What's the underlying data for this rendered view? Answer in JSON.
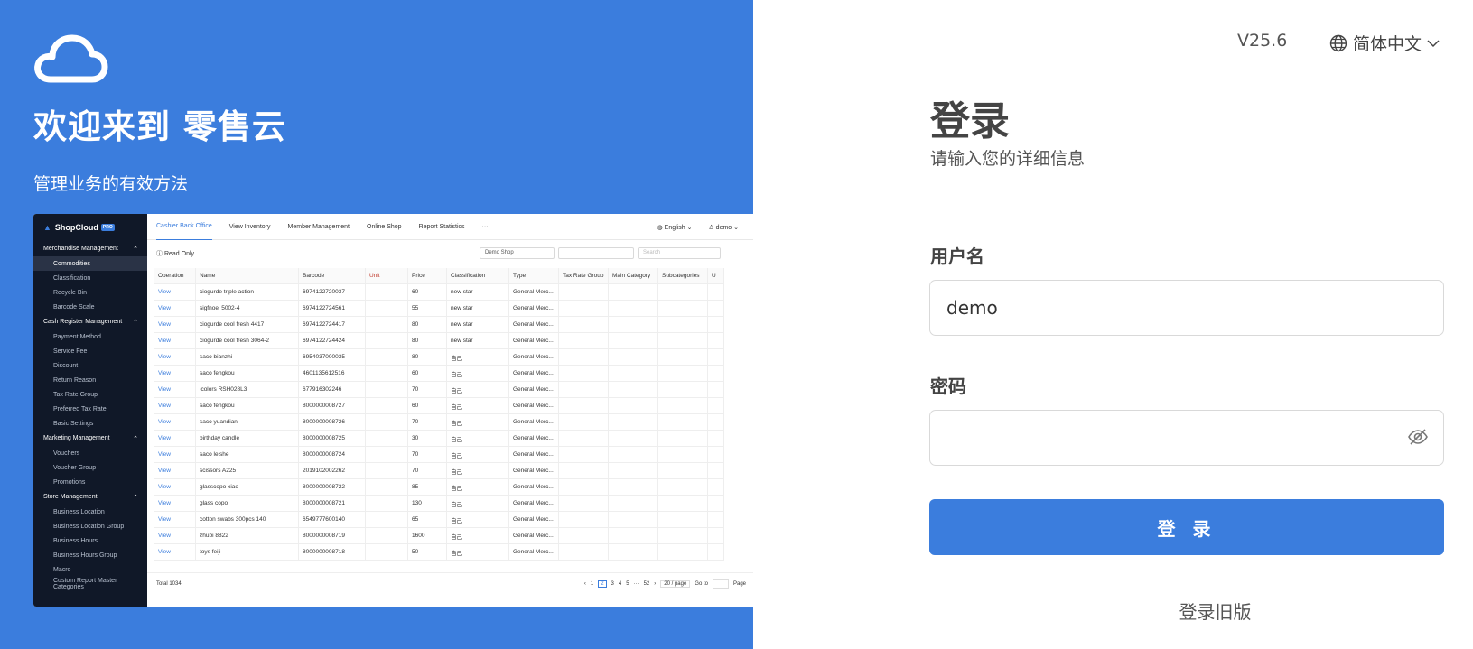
{
  "hero": {
    "welcome": "欢迎来到 零售云",
    "tagline": "管理业务的有效方法"
  },
  "preview": {
    "brand": "ShopCloud",
    "brand_badge": "PRO",
    "sidebar": [
      {
        "type": "group",
        "label": "Merchandise Management"
      },
      {
        "type": "item",
        "label": "Commodities",
        "active": true
      },
      {
        "type": "item",
        "label": "Classification"
      },
      {
        "type": "item",
        "label": "Recycle Bin"
      },
      {
        "type": "item",
        "label": "Barcode Scale"
      },
      {
        "type": "group",
        "label": "Cash Register Management"
      },
      {
        "type": "item",
        "label": "Payment Method"
      },
      {
        "type": "item",
        "label": "Service Fee"
      },
      {
        "type": "item",
        "label": "Discount"
      },
      {
        "type": "item",
        "label": "Return Reason"
      },
      {
        "type": "item",
        "label": "Tax Rate Group"
      },
      {
        "type": "item",
        "label": "Preferred Tax Rate"
      },
      {
        "type": "item",
        "label": "Basic Settings"
      },
      {
        "type": "group",
        "label": "Marketing Management"
      },
      {
        "type": "item",
        "label": "Vouchers"
      },
      {
        "type": "item",
        "label": "Voucher Group"
      },
      {
        "type": "item",
        "label": "Promotions"
      },
      {
        "type": "group",
        "label": "Store Management"
      },
      {
        "type": "item",
        "label": "Business Location"
      },
      {
        "type": "item",
        "label": "Business Location Group"
      },
      {
        "type": "item",
        "label": "Business Hours"
      },
      {
        "type": "item",
        "label": "Business Hours Group"
      },
      {
        "type": "item",
        "label": "Macro"
      },
      {
        "type": "item",
        "label": "Custom Report Master Categories"
      }
    ],
    "tabs": [
      "Cashier Back Office",
      "View Inventory",
      "Member Management",
      "Online Shop",
      "Report Statistics",
      "···"
    ],
    "lang": "English",
    "user": "demo",
    "read_only": "Read Only",
    "shop_select": "Demo Shop",
    "search_placeholder": "Search",
    "columns": [
      "Operation",
      "Name",
      "Barcode",
      "Unit",
      "Price",
      "Classification",
      "Type",
      "Tax Rate Group",
      "Main Category",
      "Subcategories",
      "U"
    ],
    "rows": [
      [
        "View",
        "ciogurde triple action",
        "6974122720037",
        "",
        "60",
        "new star",
        "General Merc..."
      ],
      [
        "View",
        "sigfnoel 5002-4",
        "6974122724561",
        "",
        "55",
        "new star",
        "General Merc..."
      ],
      [
        "View",
        "ciogurde cool fresh 4417",
        "6974122724417",
        "",
        "80",
        "new star",
        "General Merc..."
      ],
      [
        "View",
        "ciogurde cool fresh 3064-2",
        "6974122724424",
        "",
        "80",
        "new star",
        "General Merc..."
      ],
      [
        "View",
        "saco bianzhi",
        "6954037000035",
        "",
        "80",
        "自己",
        "General Merc..."
      ],
      [
        "View",
        "saco fengkou",
        "4601135612516",
        "",
        "60",
        "自己",
        "General Merc..."
      ],
      [
        "View",
        "icolors RSH028L3",
        "677916302246",
        "",
        "70",
        "自己",
        "General Merc..."
      ],
      [
        "View",
        "saco fengkou",
        "8000000008727",
        "",
        "60",
        "自己",
        "General Merc..."
      ],
      [
        "View",
        "saco yuandian",
        "8000000008726",
        "",
        "70",
        "自己",
        "General Merc..."
      ],
      [
        "View",
        "birthday candle",
        "8000000008725",
        "",
        "30",
        "自己",
        "General Merc..."
      ],
      [
        "View",
        "saco leishe",
        "8000000008724",
        "",
        "70",
        "自己",
        "General Merc..."
      ],
      [
        "View",
        "scissors A225",
        "2019102002262",
        "",
        "70",
        "自己",
        "General Merc..."
      ],
      [
        "View",
        "glasscopo xiao",
        "8000000008722",
        "",
        "85",
        "自己",
        "General Merc..."
      ],
      [
        "View",
        "glass copo",
        "8000000008721",
        "",
        "130",
        "自己",
        "General Merc..."
      ],
      [
        "View",
        "cotton swabs 300pcs 140",
        "6549777600140",
        "",
        "65",
        "自己",
        "General Merc..."
      ],
      [
        "View",
        "zhubi 8822",
        "8000000008719",
        "",
        "1600",
        "自己",
        "General Merc..."
      ],
      [
        "View",
        "toys feiji",
        "8000000008718",
        "",
        "50",
        "自己",
        "General Merc..."
      ]
    ],
    "total": "Total 1034",
    "pages": [
      "1",
      "2",
      "3",
      "4",
      "5",
      "···",
      "52"
    ],
    "current_page": "2",
    "page_size": "20 / page",
    "goto": "Go to",
    "page_word": "Page"
  },
  "header": {
    "version": "V25.6",
    "language": "简体中文"
  },
  "login": {
    "title": "登录",
    "subtitle": "请输入您的详细信息",
    "username_label": "用户名",
    "username_value": "demo",
    "password_label": "密码",
    "password_value": "",
    "submit": "登 录",
    "old_version": "登录旧版"
  },
  "colors": {
    "accent": "#3b7ddd",
    "sidebar": "#101828"
  }
}
